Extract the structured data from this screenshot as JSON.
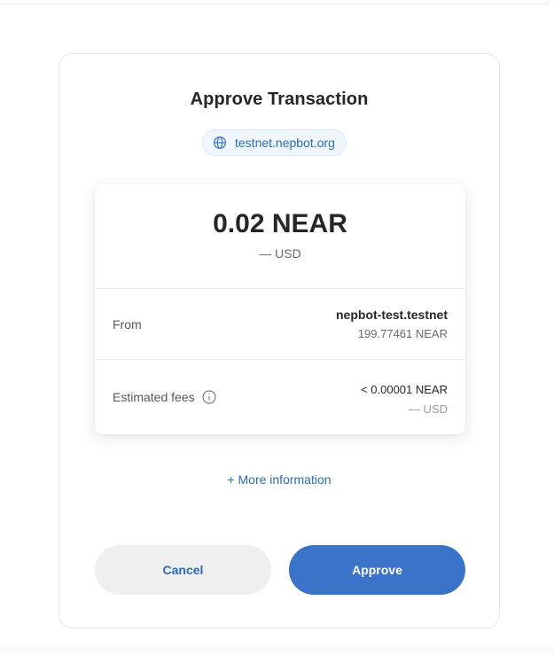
{
  "dialog": {
    "title": "Approve Transaction",
    "origin": "testnet.nepbot.org",
    "origin_icon": "globe-icon"
  },
  "summary": {
    "amount": "0.02 NEAR",
    "amount_usd": "— USD",
    "from": {
      "label": "From",
      "account": "nepbot-test.testnet",
      "balance": "199.77461 NEAR"
    },
    "fees": {
      "label": "Estimated fees",
      "info_icon": "info-icon",
      "amount": "< 0.00001 NEAR",
      "usd": "— USD"
    }
  },
  "more_info_label": "+ More information",
  "actions": {
    "cancel_label": "Cancel",
    "approve_label": "Approve"
  },
  "colors": {
    "accent": "#3b73c8",
    "link": "#2b6bbf",
    "cancel_bg": "#efefef",
    "text_primary": "#24272a"
  }
}
